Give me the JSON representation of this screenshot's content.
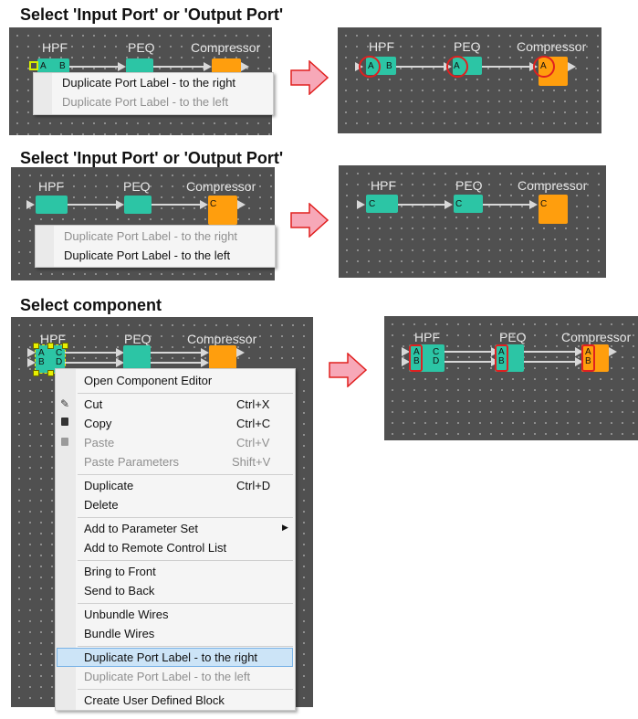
{
  "headings": {
    "h1": "Select 'Input Port' or 'Output Port'",
    "h2": "Select 'Input Port' or 'Output Port'",
    "h3": "Select component"
  },
  "components": {
    "hpf": "HPF",
    "peq": "PEQ",
    "compressor": "Compressor"
  },
  "ports": {
    "a": "A",
    "b": "B",
    "c": "C",
    "d": "D"
  },
  "menu1": {
    "items": [
      {
        "label": "Duplicate Port Label - to the right",
        "enabled": true
      },
      {
        "label": "Duplicate Port Label - to the left",
        "enabled": false
      }
    ]
  },
  "menu2": {
    "items": [
      {
        "label": "Duplicate Port Label - to the right",
        "enabled": false
      },
      {
        "label": "Duplicate Port Label - to the left",
        "enabled": true
      }
    ]
  },
  "menu3": {
    "items": [
      {
        "label": "Open Component Editor",
        "shortcut": "",
        "icon": ""
      },
      {
        "label": "Cut",
        "shortcut": "Ctrl+X",
        "icon": "pencil-icon"
      },
      {
        "label": "Copy",
        "shortcut": "Ctrl+C",
        "icon": "copy-icon"
      },
      {
        "label": "Paste",
        "shortcut": "Ctrl+V",
        "icon": "paste-icon",
        "disabled": true
      },
      {
        "label": "Paste Parameters",
        "shortcut": "Shift+V",
        "disabled": true
      },
      {
        "label": "Duplicate",
        "shortcut": "Ctrl+D"
      },
      {
        "label": "Delete",
        "shortcut": ""
      },
      {
        "label": "Add to Parameter Set",
        "shortcut": "",
        "submenu": true
      },
      {
        "label": "Add to Remote Control List",
        "shortcut": ""
      },
      {
        "label": "Bring to Front",
        "shortcut": ""
      },
      {
        "label": "Send to Back",
        "shortcut": ""
      },
      {
        "label": "Unbundle Wires",
        "shortcut": ""
      },
      {
        "label": "Bundle Wires",
        "shortcut": ""
      },
      {
        "label": "Duplicate Port Label - to the right",
        "shortcut": "",
        "highlighted": true
      },
      {
        "label": "Duplicate Port Label - to the left",
        "shortcut": "",
        "disabled": true
      },
      {
        "label": "Create User Defined Block",
        "shortcut": ""
      }
    ]
  },
  "colors": {
    "canvas": "#505050",
    "teal": "#2cc5a5",
    "orange": "#ff9e0d",
    "highlight_ring": "#e02020",
    "arrow_fill": "#f7a8b8"
  }
}
